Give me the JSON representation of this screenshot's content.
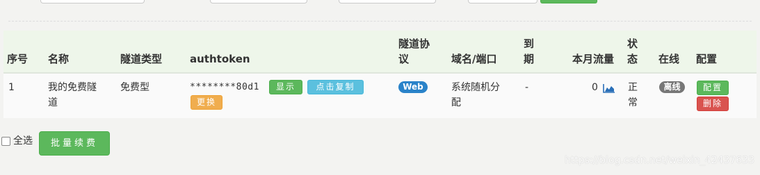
{
  "table": {
    "headers": {
      "index": "序号",
      "name": "名称",
      "tunnel_type": "隧道类型",
      "authtoken": "authtoken",
      "protocol_line1": "隧道协",
      "protocol_line2": "议",
      "domain": "域名/端口",
      "expire_line1": "到",
      "expire_line2": "期",
      "traffic": "本月流量",
      "status_line1": "状",
      "status_line2": "态",
      "online": "在线",
      "config": "配置"
    },
    "rows": [
      {
        "index": "1",
        "name_line1": "我的免费隧",
        "name_line2": "道",
        "tunnel_type": "免费型",
        "authtoken": "********80d1",
        "show_label": "显示",
        "copy_label": "点击复制",
        "change_label": "更换",
        "protocol": "Web",
        "domain_line1": "系统随机分",
        "domain_line2": "配",
        "expire": "-",
        "traffic": "0",
        "status_line1": "正",
        "status_line2": "常",
        "online": "离线",
        "config_label": "配置",
        "delete_label": "删除"
      }
    ]
  },
  "footer": {
    "select_all_label": "全选",
    "batch_renew_label": "批量续费"
  },
  "watermark": "https://blog.csdn.net/weixin_42437633",
  "icons": {
    "traffic_chart": "area-chart-icon"
  },
  "colors": {
    "accent_green": "#5cb85c",
    "info_blue": "#5bc0de",
    "danger_red": "#d9534f",
    "warning_orange": "#f0ad4e"
  }
}
